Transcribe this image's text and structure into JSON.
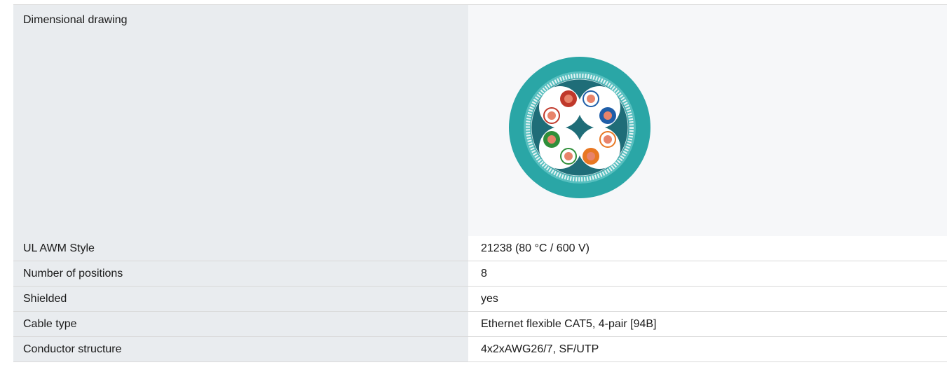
{
  "spec": {
    "rows": [
      {
        "label": "Dimensional drawing",
        "value": ""
      },
      {
        "label": "UL AWM Style",
        "value": "21238 (80 °C / 600 V)"
      },
      {
        "label": "Number of positions",
        "value": "8"
      },
      {
        "label": "Shielded",
        "value": "yes"
      },
      {
        "label": "Cable type",
        "value": "Ethernet flexible CAT5, 4-pair [94B]"
      },
      {
        "label": "Conductor structure",
        "value": "4x2xAWG26/7, SF/UTP"
      }
    ]
  },
  "figure": {
    "icon": "cable-cross-section-icon",
    "colors": {
      "jacket": "#2aa6a6",
      "shield": "#1f6d78",
      "pair_red": "#c0392b",
      "pair_blue": "#1f5ea8",
      "pair_green": "#2f8f3a",
      "pair_orange": "#e87722",
      "copper": "#e8836a"
    }
  }
}
